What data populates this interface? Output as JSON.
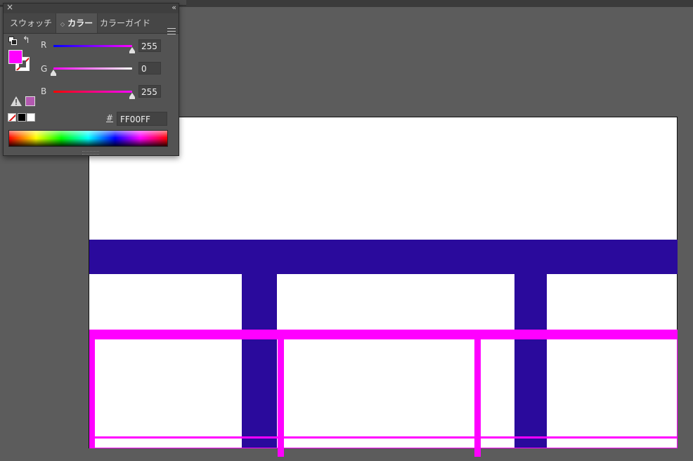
{
  "panel": {
    "tabs": [
      {
        "label": "スウォッチ"
      },
      {
        "label": "カラー"
      },
      {
        "label": "カラーガイド"
      }
    ],
    "collapse_glyph": "‹‹",
    "close_glyph": "×",
    "fill_color": "#ff00ff",
    "websafe_color": "#b359b0",
    "channels": [
      {
        "label": "R",
        "value": "255",
        "level": 1.0
      },
      {
        "label": "G",
        "value": "0",
        "level": 0.0
      },
      {
        "label": "B",
        "value": "255",
        "level": 1.0
      }
    ],
    "hash_label": "#",
    "hex_value": "FF00FF"
  },
  "artboard": {
    "navy_color": "#2a0a9c",
    "magenta_color": "#ff00ff"
  }
}
